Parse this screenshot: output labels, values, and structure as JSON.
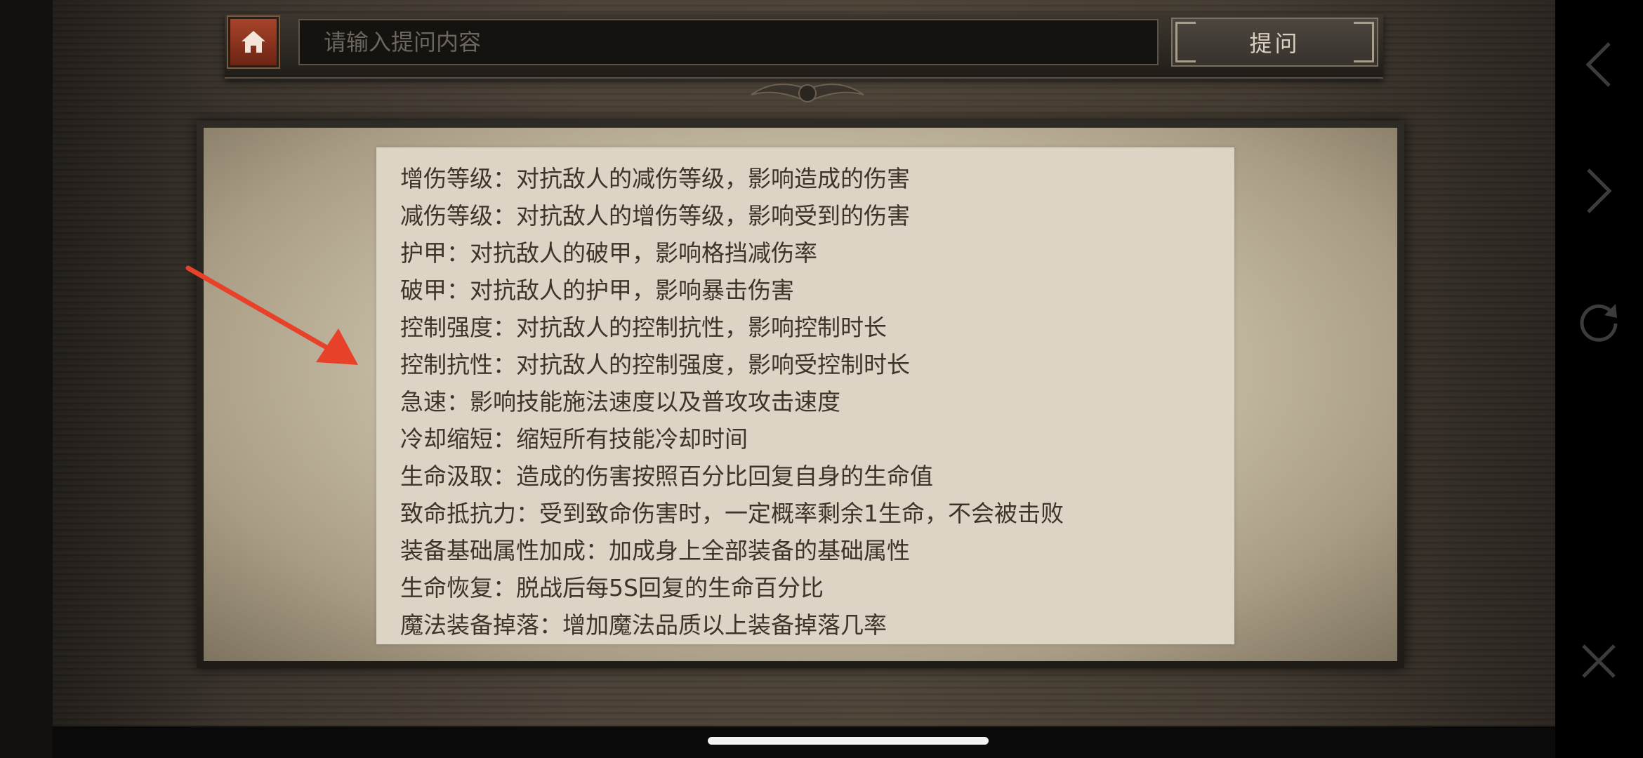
{
  "search": {
    "placeholder": "请输入提问内容"
  },
  "ask_button_label": "提问",
  "glossary_lines": [
    "增伤等级：对抗敌人的减伤等级，影响造成的伤害",
    "减伤等级：对抗敌人的增伤等级，影响受到的伤害",
    "护甲：对抗敌人的破甲，影响格挡减伤率",
    "破甲：对抗敌人的护甲，影响暴击伤害",
    "控制强度：对抗敌人的控制抗性，影响控制时长",
    "控制抗性：对抗敌人的控制强度，影响受控制时长",
    "急速：影响技能施法速度以及普攻攻击速度",
    "冷却缩短：缩短所有技能冷却时间",
    "生命汲取：造成的伤害按照百分比回复自身的生命值",
    "致命抵抗力：受到致命伤害时，一定概率剩余1生命，不会被击败",
    "装备基础属性加成：加成身上全部装备的基础属性",
    "生命恢复：脱战后每5S回复的生命百分比",
    "魔法装备掉落：增加魔法品质以上装备掉落几率"
  ],
  "colors": {
    "accent_red": "#e8412a",
    "home_button": "#a8442a",
    "text": "#3e3428"
  },
  "icons": {
    "home": "home-icon",
    "back": "chevron-left-icon",
    "forward": "chevron-right-icon",
    "refresh": "refresh-icon",
    "close": "close-icon"
  }
}
